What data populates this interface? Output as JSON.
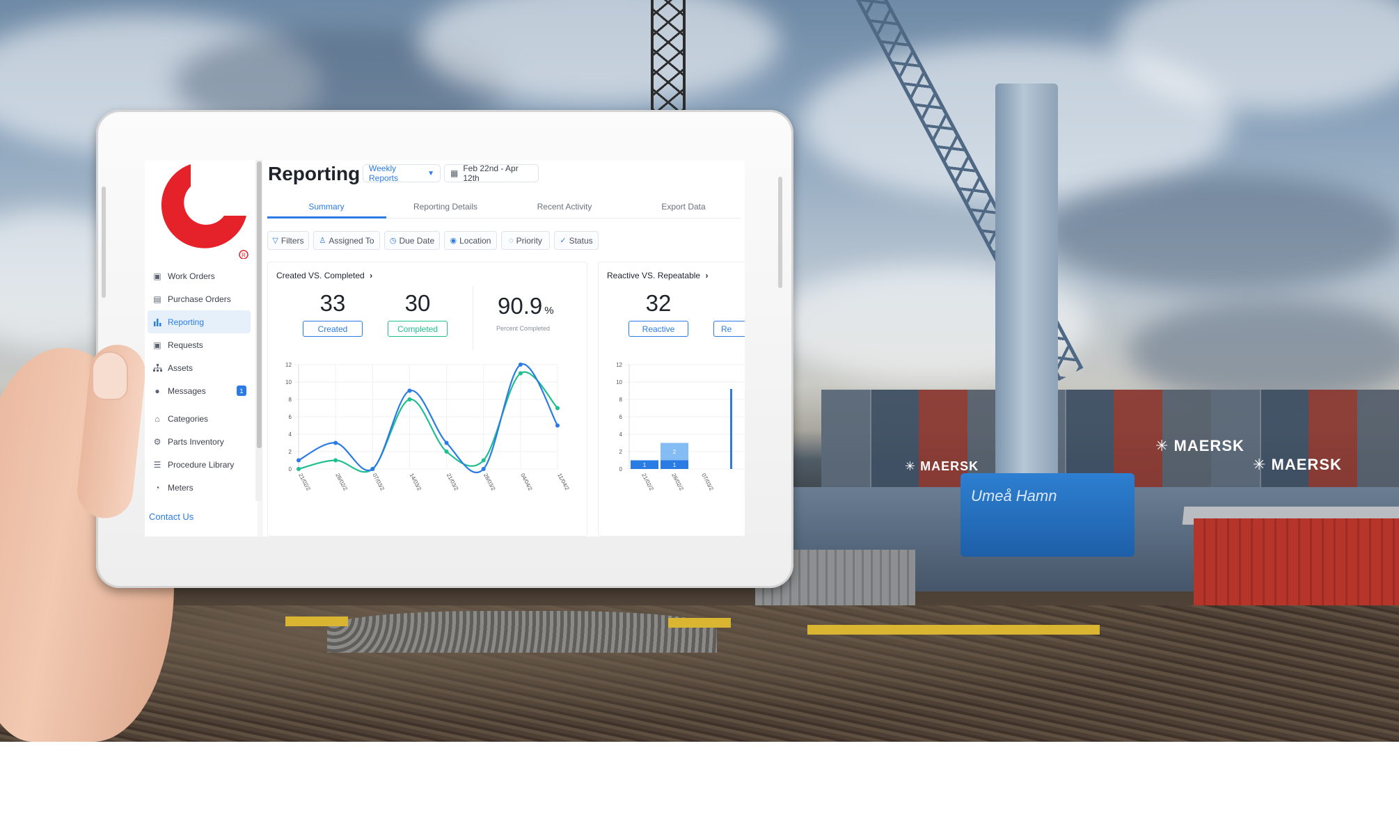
{
  "app": {
    "page_title": "Reporting",
    "report_select": "Weekly Reports",
    "date_range": "Feb 22nd - Apr 12th",
    "tabs": [
      {
        "label": "Summary",
        "active": true
      },
      {
        "label": "Reporting Details",
        "active": false
      },
      {
        "label": "Recent Activity",
        "active": false
      },
      {
        "label": "Export Data",
        "active": false
      }
    ],
    "filters": [
      {
        "label": "Filters",
        "icon": "filter-icon"
      },
      {
        "label": "Assigned To",
        "icon": "user-icon"
      },
      {
        "label": "Due Date",
        "icon": "clock-icon"
      },
      {
        "label": "Location",
        "icon": "location-pin-icon"
      },
      {
        "label": "Priority",
        "icon": "chat-bubble-icon"
      },
      {
        "label": "Status",
        "icon": "check-circle-icon"
      }
    ]
  },
  "sidebar": {
    "items": [
      {
        "label": "Work Orders",
        "icon": "inbox-icon",
        "active": false
      },
      {
        "label": "Purchase Orders",
        "icon": "document-icon",
        "active": false
      },
      {
        "label": "Reporting",
        "icon": "bar-chart-icon",
        "active": true
      },
      {
        "label": "Requests",
        "icon": "inbox-icon",
        "active": false
      },
      {
        "label": "Assets",
        "icon": "hierarchy-icon",
        "active": false
      },
      {
        "label": "Messages",
        "icon": "chat-icon",
        "active": false,
        "badge": "1"
      },
      {
        "label": "Categories",
        "icon": "tag-icon",
        "active": false
      },
      {
        "label": "Parts Inventory",
        "icon": "gear-icon",
        "active": false
      },
      {
        "label": "Procedure Library",
        "icon": "list-icon",
        "active": false
      },
      {
        "label": "Meters",
        "icon": "gauge-icon",
        "active": false
      }
    ],
    "contact": "Contact Us",
    "logo_mark": "®"
  },
  "cards": {
    "created_vs_completed": {
      "title": "Created VS. Completed",
      "created_value": "33",
      "created_label": "Created",
      "completed_value": "30",
      "completed_label": "Completed",
      "percent_value": "90.9",
      "percent_unit": "%",
      "percent_label": "Percent Completed"
    },
    "reactive_vs_repeatable": {
      "title": "Reactive VS. Repeatable",
      "reactive_value": "32",
      "reactive_label": "Reactive",
      "repeatable_label_partial": "Re"
    }
  },
  "chart_data": [
    {
      "type": "line",
      "x": [
        "21/02/2",
        "28/02/2",
        "07/03/2",
        "14/03/2",
        "21/03/2",
        "28/03/2",
        "04/04/2",
        "11/04/2"
      ],
      "series": [
        {
          "values": [
            1,
            3,
            0,
            9,
            3,
            0,
            12,
            5
          ],
          "color": "#2a7be4"
        },
        {
          "values": [
            0,
            1,
            0,
            8,
            2,
            1,
            11,
            7
          ],
          "color": "#1fbf8f"
        }
      ],
      "yticks": [
        0,
        2,
        4,
        6,
        8,
        10,
        12
      ],
      "ylim": [
        0,
        12
      ],
      "grid": true
    },
    {
      "type": "bar",
      "categories": [
        "21/02/2",
        "28/02/2",
        "07/03/2"
      ],
      "series": [
        {
          "values": [
            1,
            1,
            0
          ],
          "color": "#2a7be4"
        },
        {
          "values": [
            0,
            2,
            0
          ],
          "color": "#6fb0f2"
        }
      ],
      "data_labels": [
        "1",
        "1",
        "2"
      ],
      "yticks": [
        0,
        2,
        4,
        6,
        8,
        10,
        12
      ],
      "ylim": [
        0,
        12
      ],
      "grid": true
    }
  ],
  "colors": {
    "accent": "#2a7be4",
    "success": "#1fbf8f",
    "logo": "#e5222a"
  }
}
